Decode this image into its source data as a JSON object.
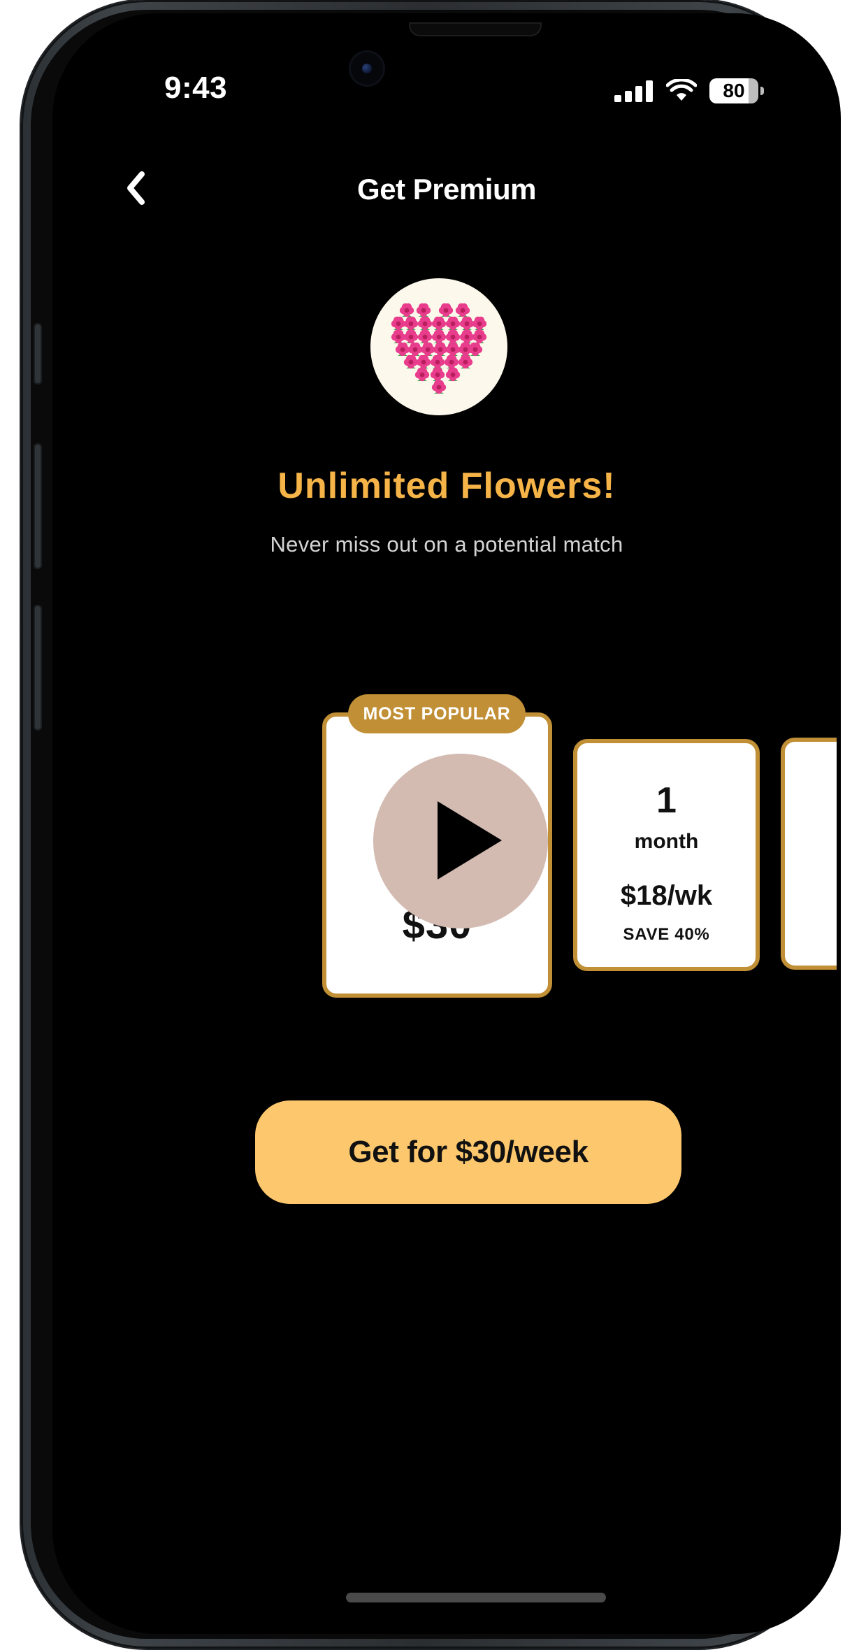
{
  "status_bar": {
    "time": "9:43",
    "battery": "80",
    "icons": [
      "signal-icon",
      "wifi-icon",
      "battery-icon"
    ]
  },
  "navigation": {
    "title": "Get Premium",
    "back_icon": "back-chevron-icon"
  },
  "feature": {
    "icon": "heart-of-flowers-icon",
    "title": "Unlimited Flowers!",
    "subtitle": "Never miss out on a potential match"
  },
  "plans": {
    "featured": {
      "badge": "MOST POPULAR",
      "price": "$30",
      "overlay_icon": "play-icon"
    },
    "secondary": {
      "duration": "1",
      "unit": "month",
      "price": "$18/wk",
      "save_text": "SAVE 40%"
    }
  },
  "cta": {
    "label": "Get for $30/week"
  },
  "colors": {
    "background": "#000000",
    "accent_gold": "#c18f35",
    "title_gold": "#f6b448",
    "button_yellow": "#fdc86d",
    "play_overlay": "#d3bbb2"
  }
}
